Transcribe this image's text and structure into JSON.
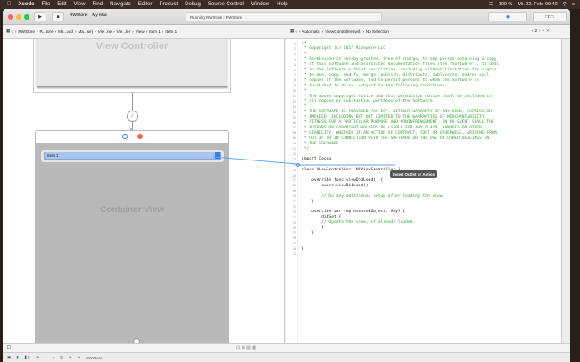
{
  "menubar": {
    "items": [
      "Xcode",
      "File",
      "Edit",
      "View",
      "Find",
      "Navigate",
      "Editor",
      "Product",
      "Debug",
      "Source Control",
      "Window",
      "Help"
    ],
    "battery": "100 %",
    "datetime": "Mi. 22. Feb.  09:40"
  },
  "toolbar": {
    "scheme": "RWStore",
    "destination": "My Mac",
    "status": "Running RWStore : RWStore"
  },
  "jumpbar_left": [
    "RWStore",
    "R...tore",
    "Ma...ard",
    "Ma...se)",
    "Vie...ne",
    "Vie...ler",
    "View",
    "Item 1",
    "Item 1"
  ],
  "jumpbar_right": {
    "mode": "Automatic",
    "file": "ViewController.swift",
    "selection": "No Selection",
    "counter": "2"
  },
  "canvas": {
    "top_scene_title": "View Controller",
    "container_label": "Container View",
    "popup_item": "Item 1"
  },
  "code": [
    {
      "n": "1",
      "t": "/*",
      "c": "cm"
    },
    {
      "n": "2",
      "t": " * Copyright (c) 2017 Razeware LLC",
      "c": "cm"
    },
    {
      "n": "3",
      "t": " *",
      "c": "cm"
    },
    {
      "n": "4",
      "t": " * Permission is hereby granted, free of charge, to any person obtaining a copy",
      "c": "cm"
    },
    {
      "n": "5",
      "t": " * of this software and associated documentation files (the \"Software\"), to deal",
      "c": "cm"
    },
    {
      "n": "6",
      "t": " * in the Software without restriction, including without limitation the rights",
      "c": "cm"
    },
    {
      "n": "7",
      "t": " * to use, copy, modify, merge, publish, distribute, sublicense, and/or sell",
      "c": "cm"
    },
    {
      "n": "8",
      "t": " * copies of the Software, and to permit persons to whom the Software is",
      "c": "cm"
    },
    {
      "n": "9",
      "t": " * furnished to do so, subject to the following conditions:",
      "c": "cm"
    },
    {
      "n": "10",
      "t": " *",
      "c": "cm"
    },
    {
      "n": "11",
      "t": " * The above copyright notice and this permission notice shall be included in",
      "c": "cm"
    },
    {
      "n": "12",
      "t": " * all copies or substantial portions of the Software.",
      "c": "cm"
    },
    {
      "n": "13",
      "t": " *",
      "c": "cm"
    },
    {
      "n": "14",
      "t": " * THE SOFTWARE IS PROVIDED \"AS IS\", WITHOUT WARRANTY OF ANY KIND, EXPRESS OR",
      "c": "cm"
    },
    {
      "n": "15",
      "t": " * IMPLIED, INCLUDING BUT NOT LIMITED TO THE WARRANTIES OF MERCHANTABILITY,",
      "c": "cm"
    },
    {
      "n": "16",
      "t": " * FITNESS FOR A PARTICULAR PURPOSE AND NONINFRINGEMENT. IN NO EVENT SHALL THE",
      "c": "cm"
    },
    {
      "n": "17",
      "t": " * AUTHORS OR COPYRIGHT HOLDERS BE LIABLE FOR ANY CLAIM, DAMAGES OR OTHER",
      "c": "cm"
    },
    {
      "n": "18",
      "t": " * LIABILITY, WHETHER IN AN ACTION OF CONTRACT, TORT OR OTHERWISE, ARISING FROM,",
      "c": "cm"
    },
    {
      "n": "19",
      "t": " * OUT OF OR IN CONNECTION WITH THE SOFTWARE OR THE USE OR OTHER DEALINGS IN",
      "c": "cm"
    },
    {
      "n": "20",
      "t": " * THE SOFTWARE.",
      "c": "cm"
    },
    {
      "n": "21",
      "t": " */",
      "c": "cm"
    },
    {
      "n": "22",
      "t": "",
      "c": ""
    },
    {
      "n": "23",
      "t": "import Cocoa",
      "c": ""
    },
    {
      "n": "24",
      "t": "",
      "c": ""
    },
    {
      "n": "25",
      "t": "class ViewController: NSViewController {",
      "c": ""
    },
    {
      "n": "26",
      "t": "",
      "c": ""
    },
    {
      "n": "27",
      "t": "    override func viewDidLoad() {",
      "c": ""
    },
    {
      "n": "28",
      "t": "        super.viewDidLoad()",
      "c": ""
    },
    {
      "n": "29",
      "t": "",
      "c": ""
    },
    {
      "n": "30",
      "t": "        // Do any additional setup after loading the view.",
      "c": "cm"
    },
    {
      "n": "31",
      "t": "    }",
      "c": ""
    },
    {
      "n": "32",
      "t": "",
      "c": ""
    },
    {
      "n": "33",
      "t": "    override var representedObject: Any? {",
      "c": ""
    },
    {
      "n": "34",
      "t": "        didSet {",
      "c": ""
    },
    {
      "n": "35",
      "t": "        // Update the view, if already loaded.",
      "c": "cm"
    },
    {
      "n": "36",
      "t": "        }",
      "c": ""
    },
    {
      "n": "37",
      "t": "    }",
      "c": ""
    },
    {
      "n": "38",
      "t": "",
      "c": ""
    },
    {
      "n": "39",
      "t": "",
      "c": ""
    },
    {
      "n": "40",
      "t": "}",
      "c": ""
    },
    {
      "n": "41",
      "t": "",
      "c": ""
    }
  ],
  "tooltip": "Insert Outlet or Action",
  "debugbar": {
    "target": "RWStore"
  },
  "colors": {
    "accent": "#2f7ef6",
    "comment": "#3aa435",
    "keyword": "#b0268f",
    "connection": "#5aaef5"
  }
}
